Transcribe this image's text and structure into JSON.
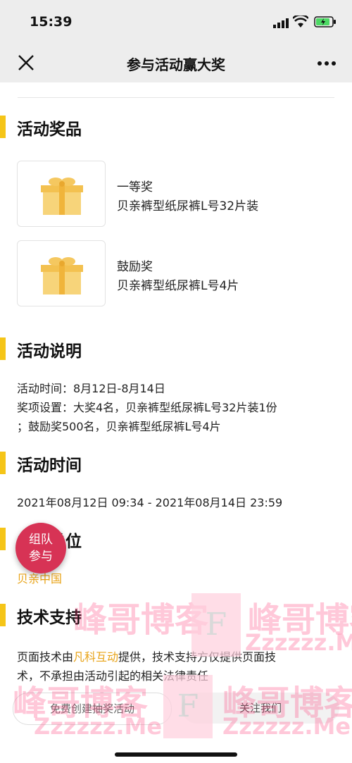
{
  "status": {
    "time": "15:39"
  },
  "nav": {
    "title": "参与活动赢大奖"
  },
  "sections": {
    "prizes": "活动奖品",
    "desc": "活动说明",
    "time": "活动时间",
    "organizer": "主办单位",
    "tech": "技术支持"
  },
  "prizes": [
    {
      "name": "一等奖",
      "desc": "贝亲裤型纸尿裤L号32片装"
    },
    {
      "name": "鼓励奖",
      "desc": "贝亲裤型纸尿裤L号4片"
    }
  ],
  "description": {
    "line1": "活动时间：8月12日-8月14日",
    "line2": "奖项设置：大奖4名，贝亲裤型纸尿裤L号32片装1份",
    "line3": "；鼓励奖500名，贝亲裤型纸尿裤L号4片"
  },
  "time_range": "2021年08月12日 09:34 - 2021年08月14日 23:59",
  "organizer": "贝亲中国",
  "tech": {
    "prefix": "页面技术由",
    "provider": "凡科互动",
    "suffix": "提供，技术支持方仅提供页面技",
    "line2": "术，不承担由活动引起的相关法律责任"
  },
  "fab": {
    "line1": "组队",
    "line2": "参与"
  },
  "bottom": {
    "create": "免费创建抽奖活动",
    "contact": "关注我们"
  },
  "watermark": {
    "cn": "峰哥博客",
    "en": "Zzzzzz.Me",
    "letter": "F"
  },
  "colors": {
    "accent": "#f5c518",
    "link": "#e8a317",
    "fab": "#d73355"
  }
}
